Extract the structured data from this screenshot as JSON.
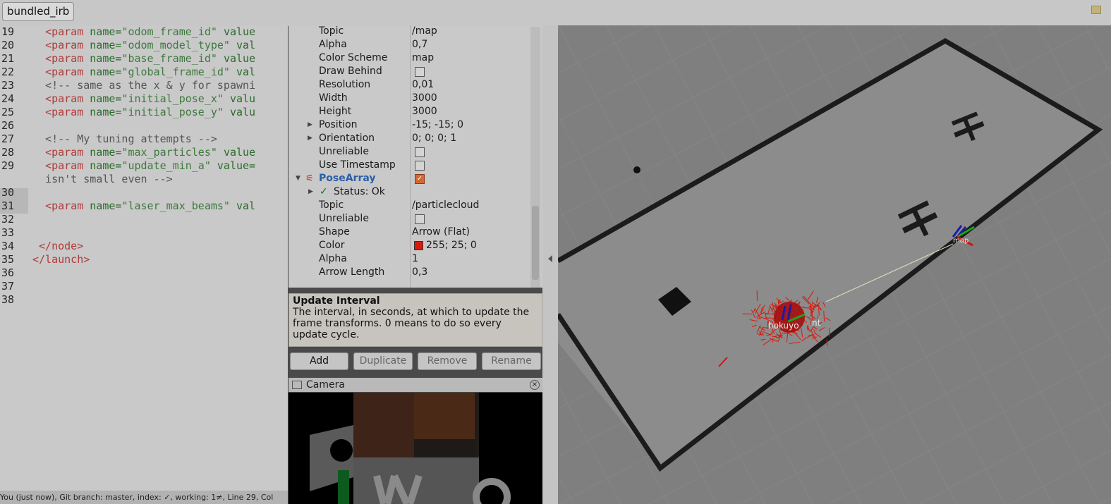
{
  "window": {
    "tab_title": "bundled_irb"
  },
  "editor": {
    "lines": [
      {
        "num": "19",
        "tokens": [
          [
            "pl",
            "  "
          ],
          [
            "tg",
            "<param"
          ],
          [
            "pl",
            " "
          ],
          [
            "at",
            "name="
          ],
          [
            "st",
            "\"odom_frame_id\""
          ],
          [
            "pl",
            " "
          ],
          [
            "at",
            "value"
          ]
        ]
      },
      {
        "num": "20",
        "tokens": [
          [
            "pl",
            "  "
          ],
          [
            "tg",
            "<param"
          ],
          [
            "pl",
            " "
          ],
          [
            "at",
            "name="
          ],
          [
            "st",
            "\"odom_model_type\""
          ],
          [
            "pl",
            " "
          ],
          [
            "at",
            "val"
          ]
        ]
      },
      {
        "num": "21",
        "tokens": [
          [
            "pl",
            "  "
          ],
          [
            "tg",
            "<param"
          ],
          [
            "pl",
            " "
          ],
          [
            "at",
            "name="
          ],
          [
            "st",
            "\"base_frame_id\""
          ],
          [
            "pl",
            " "
          ],
          [
            "at",
            "value"
          ]
        ]
      },
      {
        "num": "22",
        "tokens": [
          [
            "pl",
            "  "
          ],
          [
            "tg",
            "<param"
          ],
          [
            "pl",
            " "
          ],
          [
            "at",
            "name="
          ],
          [
            "st",
            "\"global_frame_id\""
          ],
          [
            "pl",
            " "
          ],
          [
            "at",
            "val"
          ]
        ]
      },
      {
        "num": "23",
        "tokens": [
          [
            "cm",
            "  <!-- same as the x & y for spawni"
          ]
        ]
      },
      {
        "num": "24",
        "tokens": [
          [
            "pl",
            "  "
          ],
          [
            "tg",
            "<param"
          ],
          [
            "pl",
            " "
          ],
          [
            "at",
            "name="
          ],
          [
            "st",
            "\"initial_pose_x\""
          ],
          [
            "pl",
            " "
          ],
          [
            "at",
            "valu"
          ]
        ]
      },
      {
        "num": "25",
        "tokens": [
          [
            "pl",
            "  "
          ],
          [
            "tg",
            "<param"
          ],
          [
            "pl",
            " "
          ],
          [
            "at",
            "name="
          ],
          [
            "st",
            "\"initial_pose_y\""
          ],
          [
            "pl",
            " "
          ],
          [
            "at",
            "valu"
          ]
        ]
      },
      {
        "num": "26",
        "tokens": []
      },
      {
        "num": "27",
        "tokens": [
          [
            "cm",
            "  <!-- My tuning attempts -->"
          ]
        ]
      },
      {
        "num": "28",
        "tokens": [
          [
            "pl",
            "  "
          ],
          [
            "tg",
            "<param"
          ],
          [
            "pl",
            " "
          ],
          [
            "at",
            "name="
          ],
          [
            "st",
            "\"max_particles\""
          ],
          [
            "pl",
            " "
          ],
          [
            "at",
            "value"
          ]
        ]
      },
      {
        "num": "29",
        "tokens": [
          [
            "pl",
            "  "
          ],
          [
            "tg",
            "<param"
          ],
          [
            "pl",
            " "
          ],
          [
            "at",
            "name="
          ],
          [
            "st",
            "\"update_min_a\""
          ],
          [
            "pl",
            " "
          ],
          [
            "at",
            "value="
          ]
        ]
      },
      {
        "num": "",
        "tokens": [
          [
            "cm",
            "  isn't small even -->"
          ]
        ]
      },
      {
        "num": "30",
        "tokens": []
      },
      {
        "num": "31",
        "tokens": [
          [
            "pl",
            "  "
          ],
          [
            "tg",
            "<param"
          ],
          [
            "pl",
            " "
          ],
          [
            "at",
            "name="
          ],
          [
            "st",
            "\"laser_max_beams\""
          ],
          [
            "pl",
            " "
          ],
          [
            "at",
            "val"
          ]
        ]
      },
      {
        "num": "32",
        "tokens": []
      },
      {
        "num": "33",
        "tokens": []
      },
      {
        "num": "34",
        "tokens": [
          [
            "pl",
            " "
          ],
          [
            "tg",
            "</node>"
          ]
        ]
      },
      {
        "num": "35",
        "tokens": [
          [
            "tg",
            "</launch>"
          ]
        ]
      },
      {
        "num": "36",
        "tokens": []
      },
      {
        "num": "37",
        "tokens": []
      },
      {
        "num": "38",
        "tokens": []
      }
    ],
    "status": "You (just now), Git branch: master, index: ✓, working: 1≠, Line 29, Col"
  },
  "properties": {
    "rows": [
      {
        "name": "Topic",
        "value": "/map"
      },
      {
        "name": "Alpha",
        "value": "0,7"
      },
      {
        "name": "Color Scheme",
        "value": "map"
      },
      {
        "name": "Draw Behind",
        "checkbox": false
      },
      {
        "name": "Resolution",
        "value": "0,01"
      },
      {
        "name": "Width",
        "value": "3000"
      },
      {
        "name": "Height",
        "value": "3000"
      },
      {
        "name": "Position",
        "value": "-15; -15; 0",
        "expander": true
      },
      {
        "name": "Orientation",
        "value": "0; 0; 0; 1",
        "expander": true
      },
      {
        "name": "Unreliable",
        "checkbox": false
      },
      {
        "name": "Use Timestamp",
        "checkbox": false
      },
      {
        "name": "PoseArray",
        "checkbox": true,
        "display": true
      },
      {
        "name": "Status: Ok",
        "status": true,
        "expander": true
      },
      {
        "name": "Topic",
        "value": "/particlecloud"
      },
      {
        "name": "Unreliable",
        "checkbox": false
      },
      {
        "name": "Shape",
        "value": "Arrow (Flat)"
      },
      {
        "name": "Color",
        "value": "255; 25; 0",
        "swatch": "#d81a0b"
      },
      {
        "name": "Alpha",
        "value": "1"
      },
      {
        "name": "Arrow Length",
        "value": "0,3"
      }
    ]
  },
  "description": {
    "title": "Update Interval",
    "text": "The interval, in seconds, at which to update the frame transforms. 0 means to do so every update cycle."
  },
  "buttons": {
    "add": "Add",
    "duplicate": "Duplicate",
    "remove": "Remove",
    "rename": "Rename"
  },
  "camera": {
    "title": "Camera"
  },
  "viewport": {
    "labels": {
      "robot": "hokuyo",
      "robot2": "nt",
      "goal": "map"
    }
  },
  "colors": {
    "particles": "#d81a0b",
    "accent": "#2b5ea7"
  }
}
